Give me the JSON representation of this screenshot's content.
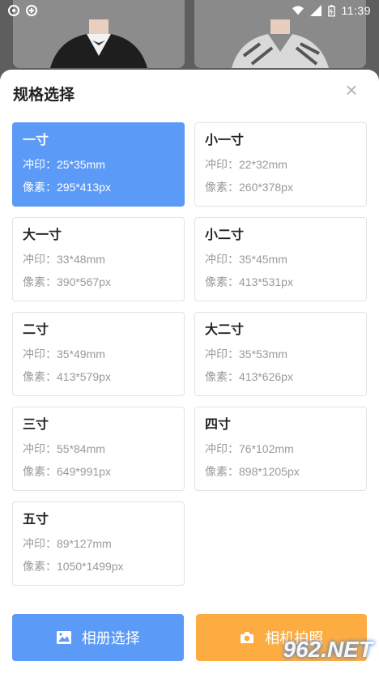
{
  "status_bar": {
    "time": "11:39"
  },
  "sheet": {
    "title": "规格选择",
    "close_glyph": "×"
  },
  "specs": [
    {
      "name": "一寸",
      "print": "冲印：25*35mm",
      "pixel": "像素：295*413px",
      "selected": true
    },
    {
      "name": "小一寸",
      "print": "冲印：22*32mm",
      "pixel": "像素：260*378px",
      "selected": false
    },
    {
      "name": "大一寸",
      "print": "冲印：33*48mm",
      "pixel": "像素：390*567px",
      "selected": false
    },
    {
      "name": "小二寸",
      "print": "冲印：35*45mm",
      "pixel": "像素：413*531px",
      "selected": false
    },
    {
      "name": "二寸",
      "print": "冲印：35*49mm",
      "pixel": "像素：413*579px",
      "selected": false
    },
    {
      "name": "大二寸",
      "print": "冲印：35*53mm",
      "pixel": "像素：413*626px",
      "selected": false
    },
    {
      "name": "三寸",
      "print": "冲印：55*84mm",
      "pixel": "像素：649*991px",
      "selected": false
    },
    {
      "name": "四寸",
      "print": "冲印：76*102mm",
      "pixel": "像素：898*1205px",
      "selected": false
    },
    {
      "name": "五寸",
      "print": "冲印：89*127mm",
      "pixel": "像素：1050*1499px",
      "selected": false
    }
  ],
  "actions": {
    "album_label": "相册选择",
    "camera_label": "相机拍照"
  },
  "watermark": {
    "text": "962.NET"
  },
  "colors": {
    "accent_blue": "#5b9af7",
    "accent_orange": "#fdac42"
  }
}
